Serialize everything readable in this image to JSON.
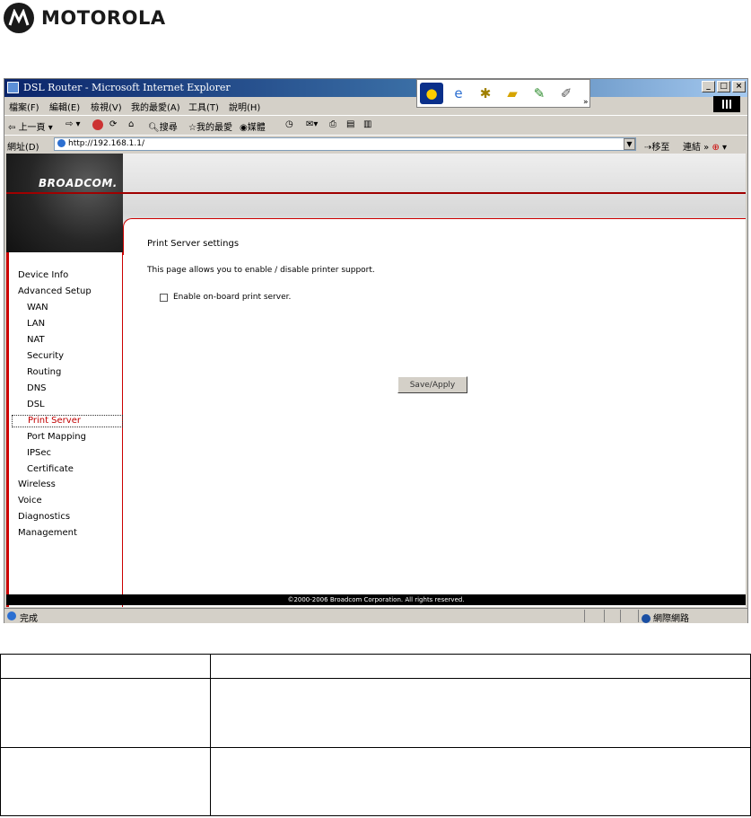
{
  "header": {
    "brand": "MOTOROLA"
  },
  "browser": {
    "title": "DSL Router - Microsoft Internet Explorer",
    "menu": [
      "檔案(F)",
      "編輯(E)",
      "檢視(V)",
      "我的最愛(A)",
      "工具(T)",
      "說明(H)"
    ],
    "toolbar": {
      "back": "上一頁",
      "search": "搜尋",
      "favorites": "我的最愛",
      "media": "媒體"
    },
    "address": {
      "label": "網址(D)",
      "url": "http://192.168.1.1/",
      "go": "移至",
      "links": "連結"
    },
    "status": {
      "text": "完成",
      "zone": "網際網路"
    }
  },
  "page": {
    "brand": "BROADCOM.",
    "title": "Print Server settings",
    "description": "This page allows you to enable / disable printer support.",
    "checkbox_label": "Enable on-board print server.",
    "checkbox_checked": false,
    "save_button": "Save/Apply",
    "footer": "©2000-2006 Broadcom Corporation. All rights reserved."
  },
  "nav": {
    "device_info": "Device Info",
    "advanced_setup": "Advanced Setup",
    "wan": "WAN",
    "lan": "LAN",
    "nat": "NAT",
    "security": "Security",
    "routing": "Routing",
    "dns": "DNS",
    "dsl": "DSL",
    "print_server": "Print Server",
    "port_mapping": "Port Mapping",
    "ipsec": "IPSec",
    "certificate": "Certificate",
    "wireless": "Wireless",
    "voice": "Voice",
    "diagnostics": "Diagnostics",
    "management": "Management"
  },
  "colors": {
    "accent": "#cc0000",
    "titlebar": "#0a246a"
  }
}
